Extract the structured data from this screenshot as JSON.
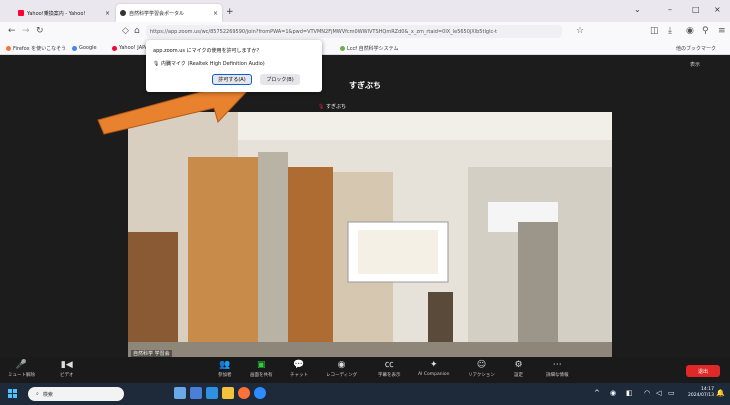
{
  "browser": {
    "tabs": [
      {
        "label": "Yahoo!乗換案内 - Yahoo!",
        "active": false
      },
      {
        "label": "自然科学学習会ポータル",
        "active": true
      }
    ],
    "url": "https://app.zoom.us/wc/85752269590/join?fromPWA=1&pwd=VTVMN2FjMWVfcm0WWlVTSHQmRZd0&_x_zm_rtaid=0IX_le5650jXlb5tIglc-t",
    "bookmarks": [
      "Firefox を使いこなそう",
      "Google",
      "Yahoo! JAPAN",
      "Lccf 自然科学システム"
    ],
    "bookmarks_right": "他のブックマーク"
  },
  "popup": {
    "title": "app.zoom.us にマイクの使用を許可しますか？",
    "device": "内臓マイク (Realtek High Definition Audio)",
    "allow": "許可する(A)",
    "block": "ブロック(B)"
  },
  "meeting": {
    "name": "すぎぶち",
    "speaker": "すぎぶち",
    "video_name": "自然科学 学習会",
    "top_right": "表示"
  },
  "toolbar": {
    "items": [
      {
        "icon": "mic-icon",
        "label": "ミュート解除"
      },
      {
        "icon": "video-icon",
        "label": "ビデオ"
      },
      {
        "icon": "participants-icon",
        "label": "参加者"
      },
      {
        "icon": "share-icon",
        "label": "画面を共有"
      },
      {
        "icon": "chat-icon",
        "label": "チャット"
      },
      {
        "icon": "record-icon",
        "label": "レコーディング"
      },
      {
        "icon": "caption-icon",
        "label": "字幕を表示"
      },
      {
        "icon": "ai-companion-icon",
        "label": "AI Companion"
      },
      {
        "icon": "reactions-icon",
        "label": "リアクション"
      },
      {
        "icon": "apps-icon",
        "label": "設定"
      },
      {
        "icon": "more-icon",
        "label": "詳細な情報"
      }
    ],
    "leave": "退出"
  },
  "taskbar": {
    "search": "検索",
    "time": "14:17",
    "date": "2024/07/13"
  },
  "colors": {
    "accent": "#0e72ed",
    "leave": "#e02828",
    "arrow": "#e8822f"
  }
}
